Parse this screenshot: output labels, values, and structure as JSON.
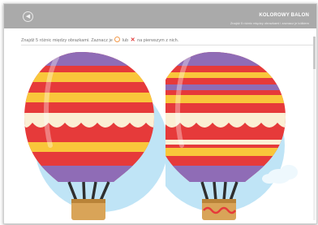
{
  "app": {
    "title": "KOLOROWY BALON",
    "subtitle": "Znajdź 5 różnic między obrazkami i zaznacz je kółkiem",
    "back_icon": "back-arrow-icon"
  },
  "game": {
    "instruction_part1": "Znajdź 5 różnic między obrazkami. Zaznacz je",
    "instruction_part2": "lub",
    "instruction_part3": "na pierwszym z nich.",
    "marker_circle_color": "#f29a4a",
    "marker_x_color": "#e03535"
  },
  "colors": {
    "topbar": "#aaaaaa",
    "sky": "#bfe4f6",
    "balloon_red": "#e63a3a",
    "balloon_yellow": "#f9c63b",
    "balloon_purple": "#8f6cb6",
    "scallop_cream": "#fbefd4",
    "basket": "#d9a458"
  }
}
